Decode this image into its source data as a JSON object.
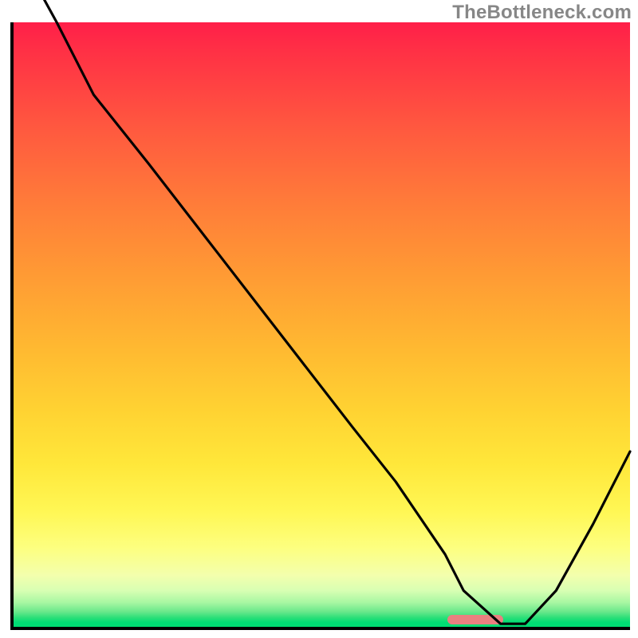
{
  "watermark": "TheBottleneck.com",
  "colors": {
    "axis": "#000000",
    "curve": "#000000",
    "marker": "#e98080",
    "gradient_top": "#ff1f49",
    "gradient_bottom": "#00dd74"
  },
  "chart_data": {
    "type": "line",
    "title": "",
    "xlabel": "",
    "ylabel": "",
    "xlim": [
      0,
      100
    ],
    "ylim": [
      0,
      100
    ],
    "x": [
      0,
      7,
      13,
      22,
      33,
      44,
      55,
      62,
      70,
      73,
      79,
      83,
      88,
      94,
      100
    ],
    "values": [
      113,
      100,
      88,
      76.5,
      62,
      47.5,
      33,
      24,
      12,
      6,
      0.5,
      0.5,
      6,
      17,
      29
    ],
    "marker_range_x": [
      70,
      79
    ],
    "annotations": []
  }
}
